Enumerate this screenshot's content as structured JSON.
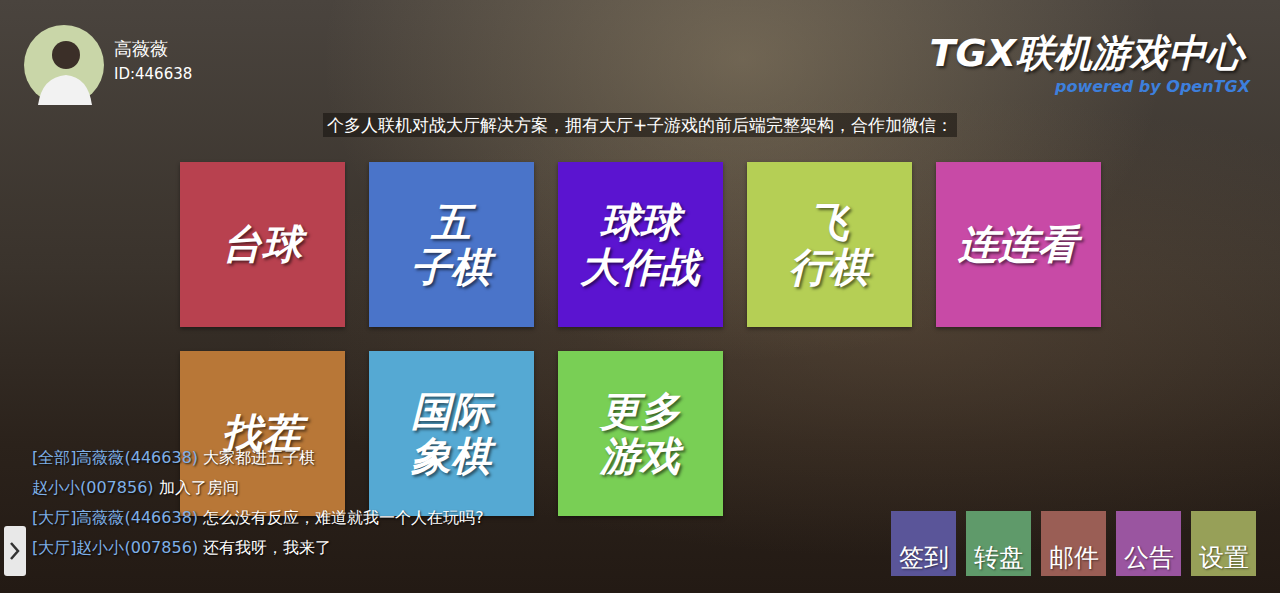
{
  "user": {
    "name": "高薇薇",
    "id": "ID:446638"
  },
  "header": {
    "title": "TGX联机游戏中心",
    "subtitle": "powered by OpenTGX"
  },
  "marquee": "个多人联机对战大厅解决方案，拥有大厅+子游戏的前后端完整架构，合作加微信：",
  "games": [
    {
      "lines": [
        "台球"
      ],
      "color": "#b8414f"
    },
    {
      "lines": [
        "五",
        "子棋"
      ],
      "color": "#4a74c9"
    },
    {
      "lines": [
        "球球",
        "大作战"
      ],
      "color": "#5b14d0"
    },
    {
      "lines": [
        "飞",
        "行棋"
      ],
      "color": "#b5cf55"
    },
    {
      "lines": [
        "连连看"
      ],
      "color": "#c84aa6"
    },
    {
      "lines": [
        "找茬"
      ],
      "color": "#b87737"
    },
    {
      "lines": [
        "国际",
        "象棋"
      ],
      "color": "#55a9d3"
    },
    {
      "lines": [
        "更多",
        "游戏"
      ],
      "color": "#79cf55"
    }
  ],
  "chat": [
    {
      "from": "[全部]高薇薇(446638)",
      "text": "大家都进五子棋"
    },
    {
      "from": "赵小小(007856)",
      "text": "加入了房间"
    },
    {
      "from": "[大厅]高薇薇(446638)",
      "text": "怎么没有反应，难道就我一个人在玩吗?"
    },
    {
      "from": "[大厅]赵小小(007856)",
      "text": "还有我呀，我来了"
    }
  ],
  "buttons": [
    {
      "label": "签到",
      "color": "#5a5599"
    },
    {
      "label": "转盘",
      "color": "#5f9a6a"
    },
    {
      "label": "邮件",
      "color": "#9a5e55"
    },
    {
      "label": "公告",
      "color": "#9a55a0"
    },
    {
      "label": "设置",
      "color": "#97a058"
    }
  ]
}
